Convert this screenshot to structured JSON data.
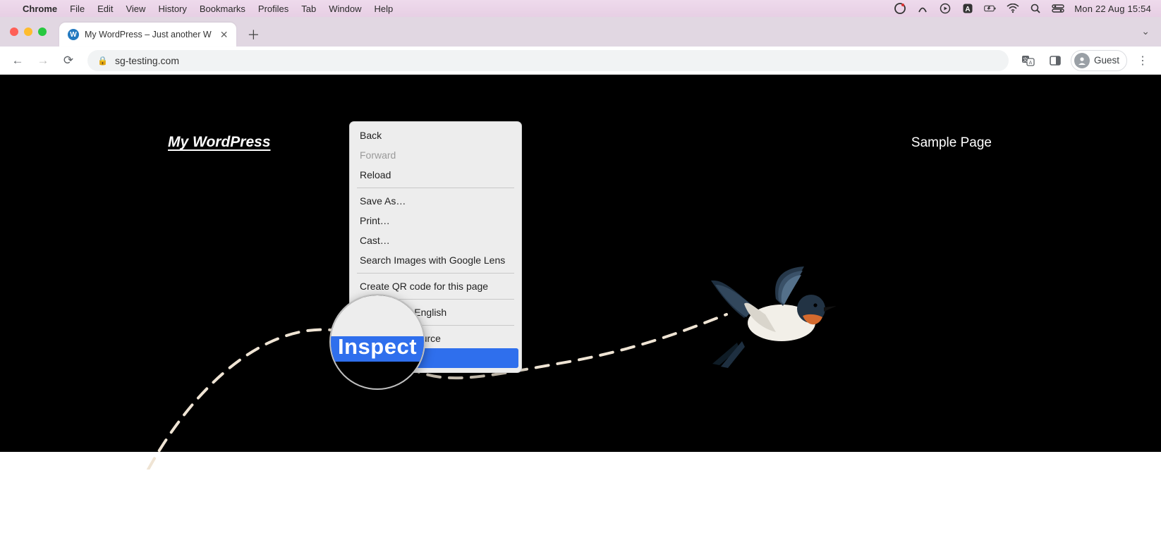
{
  "mac_menu": {
    "app": "Chrome",
    "items": [
      "File",
      "Edit",
      "View",
      "History",
      "Bookmarks",
      "Profiles",
      "Tab",
      "Window",
      "Help"
    ],
    "datetime": "Mon 22 Aug  15:54"
  },
  "status_icons": [
    "grammarly",
    "arc",
    "play-circle",
    "letter-a",
    "battery",
    "wifi",
    "spotlight",
    "control-center"
  ],
  "chrome": {
    "tab_title": "My WordPress – Just another W",
    "url": "sg-testing.com",
    "profile_label": "Guest"
  },
  "page": {
    "site_title": "My WordPress",
    "nav_link": "Sample Page"
  },
  "context_menu": {
    "items": [
      {
        "label": "Back",
        "enabled": true
      },
      {
        "label": "Forward",
        "enabled": false
      },
      {
        "label": "Reload",
        "enabled": true
      }
    ],
    "group2": [
      {
        "label": "Save As…"
      },
      {
        "label": "Print…"
      },
      {
        "label": "Cast…"
      },
      {
        "label": "Search Images with Google Lens"
      }
    ],
    "group3": [
      {
        "label": "Create QR code for this page"
      }
    ],
    "group4": [
      {
        "label": "Translate to English"
      }
    ],
    "group5": [
      {
        "label": "View Page Source"
      },
      {
        "label": "Inspect",
        "selected": true
      }
    ]
  },
  "magnifier": {
    "text": "Inspect"
  }
}
